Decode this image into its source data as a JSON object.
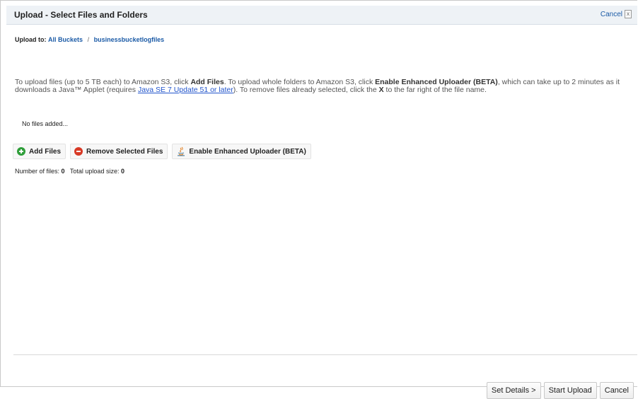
{
  "dialog": {
    "title": "Upload - Select Files and Folders",
    "cancel_link": "Cancel"
  },
  "breadcrumb": {
    "label": "Upload to:",
    "root": "All Buckets",
    "separator": "/",
    "bucket": "businessbucketlogfiles"
  },
  "info": {
    "part1": "To upload files (up to 5 TB each) to Amazon S3, click ",
    "add_files": "Add Files",
    "part2": ". To upload whole folders to Amazon S3, click ",
    "enhanced": "Enable Enhanced Uploader (BETA)",
    "part3": ", which can take up to 2 minutes as it downloads a Java™ Applet (requires ",
    "java_link": "Java SE 7 Update 51 or later",
    "part4": "). To remove files already selected, click the ",
    "x": "X",
    "part5": " to the far right of the file name."
  },
  "file_list": {
    "empty_text": "No files added..."
  },
  "toolbar": {
    "add_files": "Add Files",
    "remove_selected": "Remove Selected Files",
    "enable_enhanced": "Enable Enhanced Uploader (BETA)"
  },
  "summary": {
    "files_label": "Number of files:",
    "files_count": "0",
    "size_label": "Total upload size:",
    "size_value": "0"
  },
  "footer": {
    "set_details": "Set Details >",
    "start_upload": "Start Upload",
    "cancel": "Cancel"
  },
  "icons": {
    "add": "plus-circle-icon",
    "remove": "minus-circle-icon",
    "java": "java-icon",
    "close": "close-icon"
  }
}
